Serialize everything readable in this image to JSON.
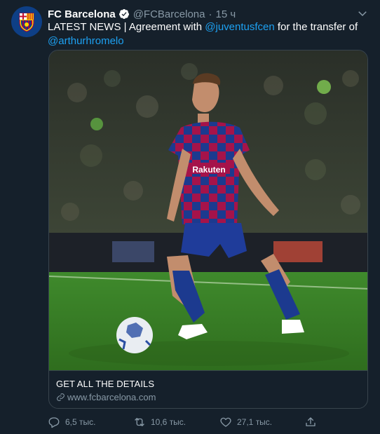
{
  "tweet": {
    "author_name": "FC Barcelona",
    "handle": "@FCBarcelona",
    "separator": "·",
    "time": "15 ч",
    "text_prefix": "LATEST NEWS | Agreement with ",
    "mention_1": "@juventusfcen",
    "text_middle": " for the transfer of ",
    "mention_2": "@arthurhromelo"
  },
  "card": {
    "title": "GET ALL THE DETAILS",
    "url": "www.fcbarcelona.com",
    "jersey_sponsor": "Rakuten"
  },
  "actions": {
    "reply_count": "6,5 тыс.",
    "retweet_count": "10,6 тыс.",
    "like_count": "27,1 тыс."
  },
  "colors": {
    "background": "#15202b",
    "accent": "#1da1f2",
    "muted": "#8899a6"
  },
  "icons": [
    "fcb-crest-icon",
    "verified-icon",
    "chevron-down-icon",
    "link-icon",
    "reply-icon",
    "retweet-icon",
    "like-icon",
    "share-icon"
  ]
}
